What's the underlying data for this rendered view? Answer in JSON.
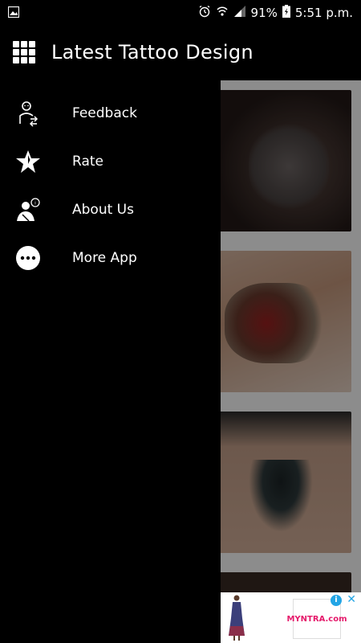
{
  "status_bar": {
    "battery": "91%",
    "time": "5:51 p.m."
  },
  "header": {
    "title": "Latest Tattoo Design"
  },
  "drawer": {
    "items": [
      {
        "label": "Feedback",
        "icon": "feedback-icon"
      },
      {
        "label": "Rate",
        "icon": "star-icon"
      },
      {
        "label": "About Us",
        "icon": "about-us-icon"
      },
      {
        "label": "More App",
        "icon": "more-icon"
      }
    ]
  },
  "ad": {
    "brand": "MYNTRA.com"
  },
  "colors": {
    "background": "#000000",
    "ad_info": "#23a5e5",
    "ad_brand": "#e5186a"
  }
}
